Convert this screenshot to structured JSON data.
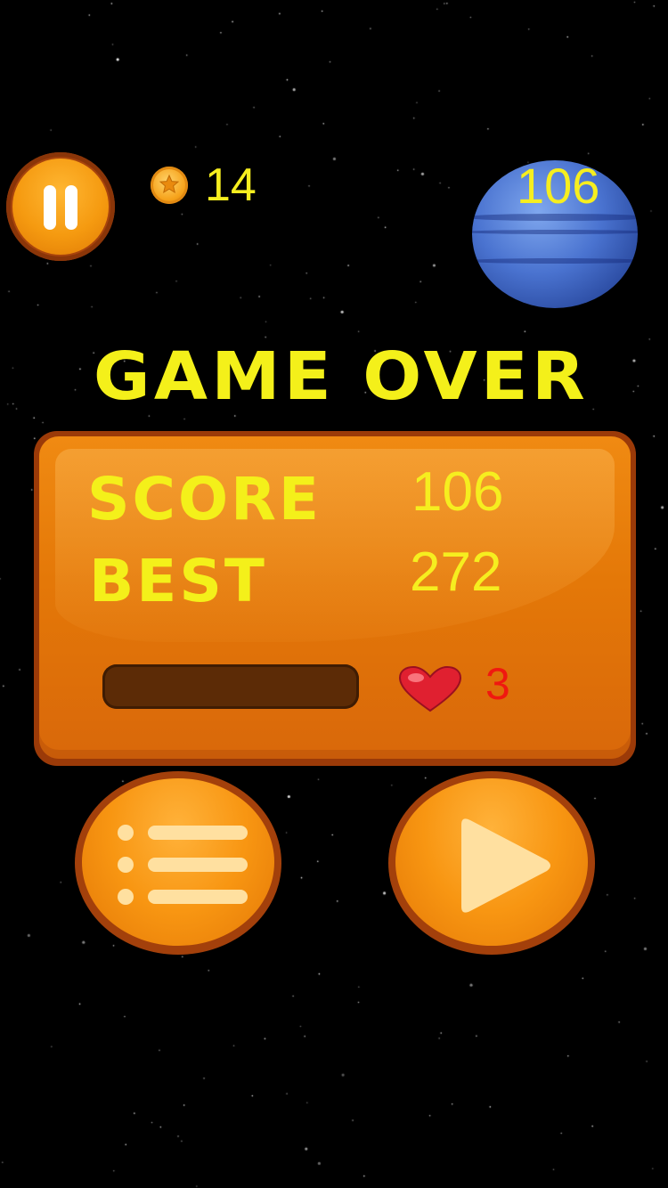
{
  "hud": {
    "coins": "14",
    "current_score": "106"
  },
  "title": "GAME OVER",
  "results": {
    "score_label": "SCORE",
    "score_value": "106",
    "best_label": "BEST",
    "best_value": "272",
    "progress": 0,
    "lives": "3"
  },
  "icons": {
    "pause": "pause-icon",
    "coin": "coin-icon",
    "heart": "heart-icon",
    "menu": "menu-icon",
    "play": "play-icon"
  },
  "colors": {
    "text_yellow": "#f4f01a",
    "panel_orange": "#e47808",
    "lives_red": "#f01810",
    "background": "#000000"
  }
}
